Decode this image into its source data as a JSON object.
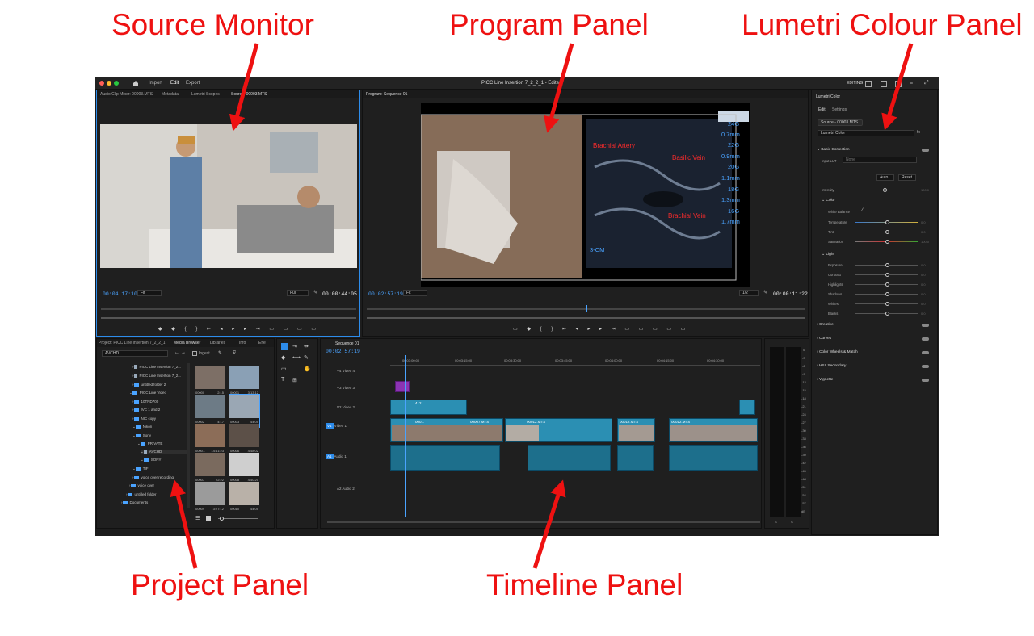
{
  "callouts": {
    "source_monitor": "Source Monitor",
    "program_panel": "Program Panel",
    "lumetri_colour_panel": "Lumetri Colour Panel",
    "project_panel": "Project Panel",
    "timeline_panel": "Timeline Panel"
  },
  "app": {
    "menu": [
      "Import",
      "Edit",
      "Export"
    ],
    "active_menu": "Edit",
    "title": "PICC Line Insertion 7_2_2_1 - Edited",
    "workspace": "EDITING"
  },
  "source": {
    "tabs": [
      "Audio Clip Mixer: 00003.MTS",
      "Metadata",
      "Lumetri Scopes",
      "Source: 00003.MTS"
    ],
    "timecode_in": "00:04:17:10",
    "fit": "Fit",
    "res": "Full",
    "timecode_out": "00:00:44:05"
  },
  "program": {
    "tab": "Program: Sequence 01",
    "timecode_in": "00:02:57:19",
    "fit": "Fit",
    "res": "1/2",
    "timecode_out": "00:00:11:22",
    "us_labels": [
      "Brachial Artery",
      "Basilic Vein",
      "Brachial Vein"
    ],
    "us_scale": [
      "24G",
      "0.7mm",
      "22G",
      "0.9mm",
      "20G",
      "1.1mm",
      "18G",
      "1.3mm",
      "16G",
      "1.7mm"
    ],
    "depth": "3-CM"
  },
  "lumetri": {
    "panel_title": "Lumetri Color",
    "tabs": [
      "Edit",
      "Settings"
    ],
    "source_chip": "Source - 00003.MTS",
    "preset": "Lumetri Color",
    "basic": "Basic Correction",
    "input_lut_label": "Input LUT",
    "input_lut_value": "None",
    "auto": "Auto",
    "reset": "Reset",
    "intensity": "Intensity",
    "color": "Color",
    "white_balance": "White Balance",
    "temperature": "Temperature",
    "tint": "Tint",
    "saturation": "Saturation",
    "light": "Light",
    "exposure": "Exposure",
    "contrast": "Contrast",
    "highlights": "Highlights",
    "shadows": "Shadows",
    "whites": "Whites",
    "blacks": "Blacks",
    "val_zero": "0.0",
    "val_hundred": "100.0",
    "sections": [
      "Creative",
      "Curves",
      "Color Wheels & Match",
      "HSL Secondary",
      "Vignette"
    ]
  },
  "project": {
    "tabs": [
      "Project: PICC Line Insertion 7_2_2_1",
      "Media Browser",
      "Libraries",
      "Info",
      "Effe"
    ],
    "location": "AVCHD",
    "ingest": "Ingest",
    "tree": [
      "PICC Line Insertion 7_2...",
      "PICC Line Insertion 7_2...",
      "untitled folder 2",
      "PICC Line Video",
      "10TND700",
      "IVC 1 and 2",
      "NIC copy",
      "Nikon",
      "Sony",
      "PRIVATE",
      "AVCHD",
      "SONY",
      "TIF",
      "voice over recording",
      "voice over",
      "untitled folder",
      "Documents"
    ],
    "clips": [
      {
        "name": "00000",
        "dur": "2:15"
      },
      {
        "name": "00001",
        "dur": "3:13:12"
      },
      {
        "name": "00002",
        "dur": "4:17"
      },
      {
        "name": "00003",
        "dur": "44:05"
      },
      {
        "name": "0000...",
        "dur": "14:41:23"
      },
      {
        "name": "00006",
        "dur": "4:48:02"
      },
      {
        "name": "00007",
        "dur": "22:22"
      },
      {
        "name": "00008",
        "dur": "4:40:20"
      },
      {
        "name": "00009",
        "dur": "3:27:12"
      },
      {
        "name": "00010",
        "dur": "44:05"
      }
    ]
  },
  "timeline": {
    "tab": "Sequence 01",
    "timecode": "00:02:57:19",
    "ruler": [
      "00:03:00:00",
      "00:03:15:00",
      "00:03:30:00",
      "00:03:45:00",
      "00:04:00:00",
      "00:04:15:00",
      "00:04:30:00"
    ],
    "tracks": [
      {
        "id": "V4",
        "name": "Video 4"
      },
      {
        "id": "V3",
        "name": "Video 3"
      },
      {
        "id": "V2",
        "name": "Video 2"
      },
      {
        "id": "V1",
        "name": "Video 1"
      },
      {
        "id": "A1",
        "name": "Audio 1"
      },
      {
        "id": "A2",
        "name": "Audio 2"
      }
    ],
    "clip_labels": [
      "000...",
      "00007.MTS",
      "00012.MTS",
      "00012.MTS",
      "00012.MTS",
      "412...",
      "fx"
    ]
  },
  "meter_scale": [
    "0",
    "-3",
    "-6",
    "-9",
    "-12",
    "-15",
    "-18",
    "-21",
    "-24",
    "-27",
    "-30",
    "-33",
    "-36",
    "-39",
    "-42",
    "-45",
    "-48",
    "-51",
    "-54",
    "-57",
    "dB"
  ],
  "meter_foot": [
    "S",
    "S"
  ],
  "colors": {
    "accent": "#2d8ceb",
    "callout": "#ee1111",
    "clip_video": "#2b8fb3",
    "clip_audio": "#1d6f8c"
  }
}
